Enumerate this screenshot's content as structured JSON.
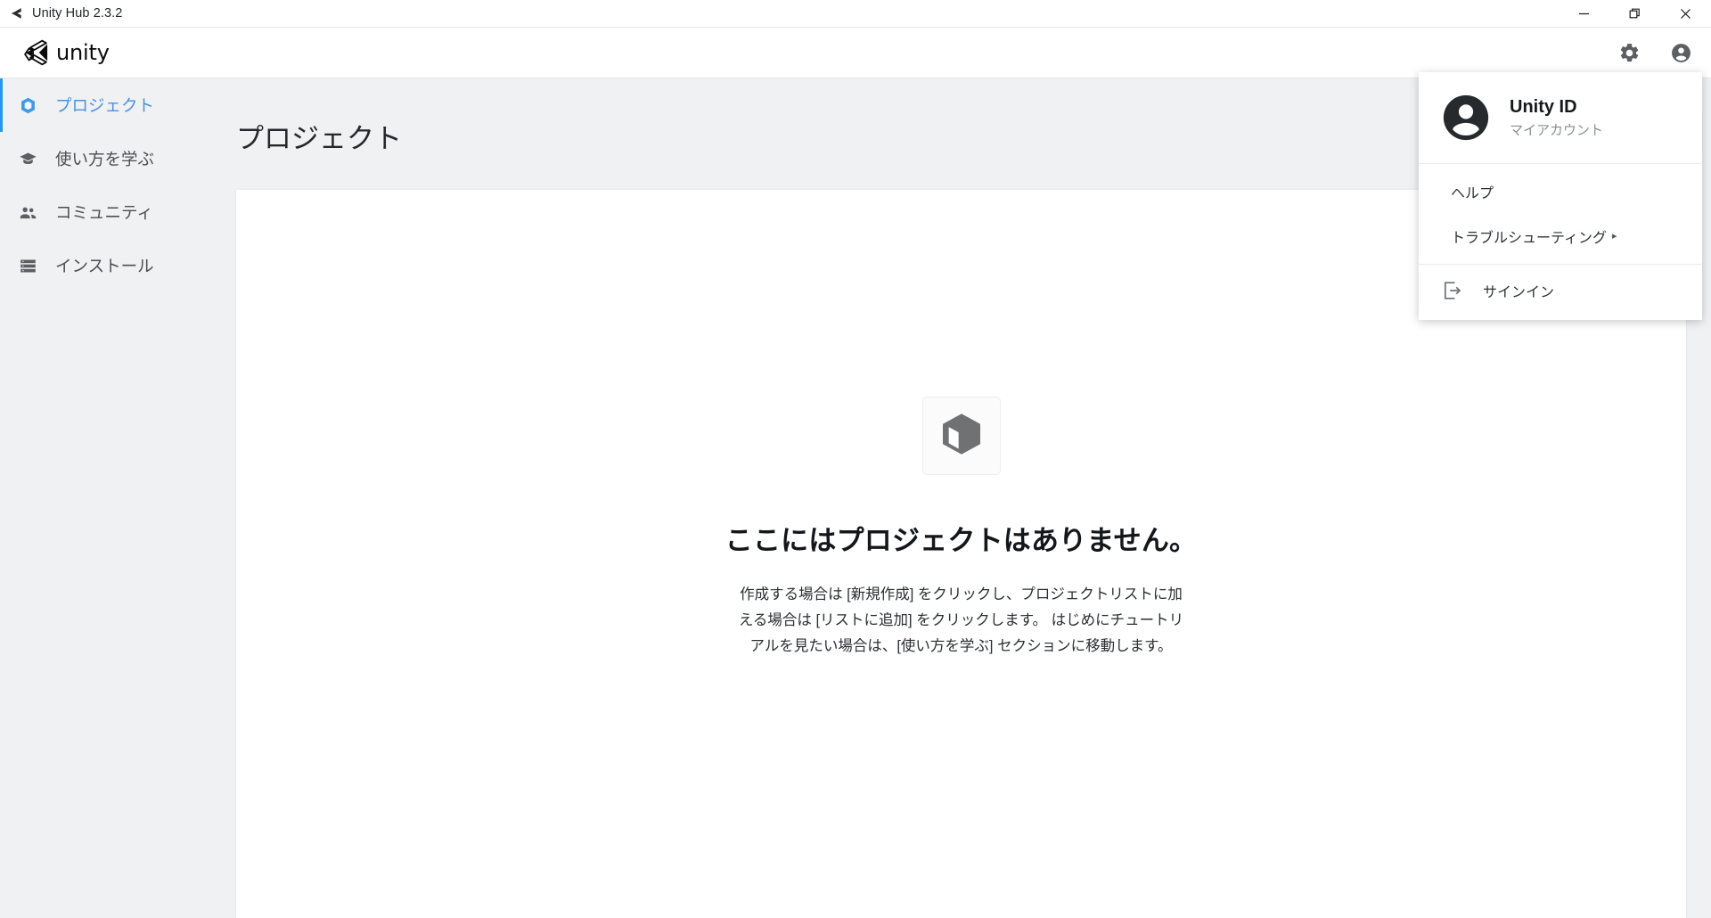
{
  "titlebar": {
    "title": "Unity Hub 2.3.2",
    "app_icon": "unity-logo-icon",
    "minimize_label": "—",
    "maximize_label": "❐",
    "close_label": "✕"
  },
  "header": {
    "logo_text": "unity",
    "settings_icon": "gear-icon",
    "account_icon": "account-circle-icon"
  },
  "sidebar": {
    "items": [
      {
        "label": "プロジェクト",
        "icon": "cube-icon",
        "active": true
      },
      {
        "label": "使い方を学ぶ",
        "icon": "graduation-cap-icon",
        "active": false
      },
      {
        "label": "コミュニティ",
        "icon": "people-icon",
        "active": false
      },
      {
        "label": "インストール",
        "icon": "list-icon",
        "active": false
      }
    ]
  },
  "main": {
    "page_title": "プロジェクト",
    "search": {
      "value": "",
      "placeholder": ""
    },
    "empty_state": {
      "icon": "cube-icon",
      "title": "ここにはプロジェクトはありません。",
      "desc_line1": "作成する場合は [新規作成] をクリックし、プロジェクトリストに加",
      "desc_line2": "える場合は [リストに追加] をクリックします。 はじめにチュートリ",
      "desc_line3": "アルを見たい場合は、[使い方を学ぶ] セクションに移動します。"
    }
  },
  "account_dropdown": {
    "avatar_icon": "account-avatar-icon",
    "name": "Unity ID",
    "subtitle": "マイアカウント",
    "menu": [
      {
        "label": "ヘルプ",
        "has_submenu": false,
        "icon": null
      },
      {
        "label": "トラブルシューティング",
        "has_submenu": true,
        "icon": null
      }
    ],
    "submenu_arrow": "▸",
    "signin": {
      "label": "サインイン",
      "icon": "sign-in-icon"
    }
  },
  "colors": {
    "accent_blue": "#2196f3",
    "active_text_blue": "#4a90e2",
    "app_bg": "#f0f1f3",
    "card_bg": "#ffffff",
    "text_primary": "#24282c",
    "text_muted": "#8a8f94"
  }
}
